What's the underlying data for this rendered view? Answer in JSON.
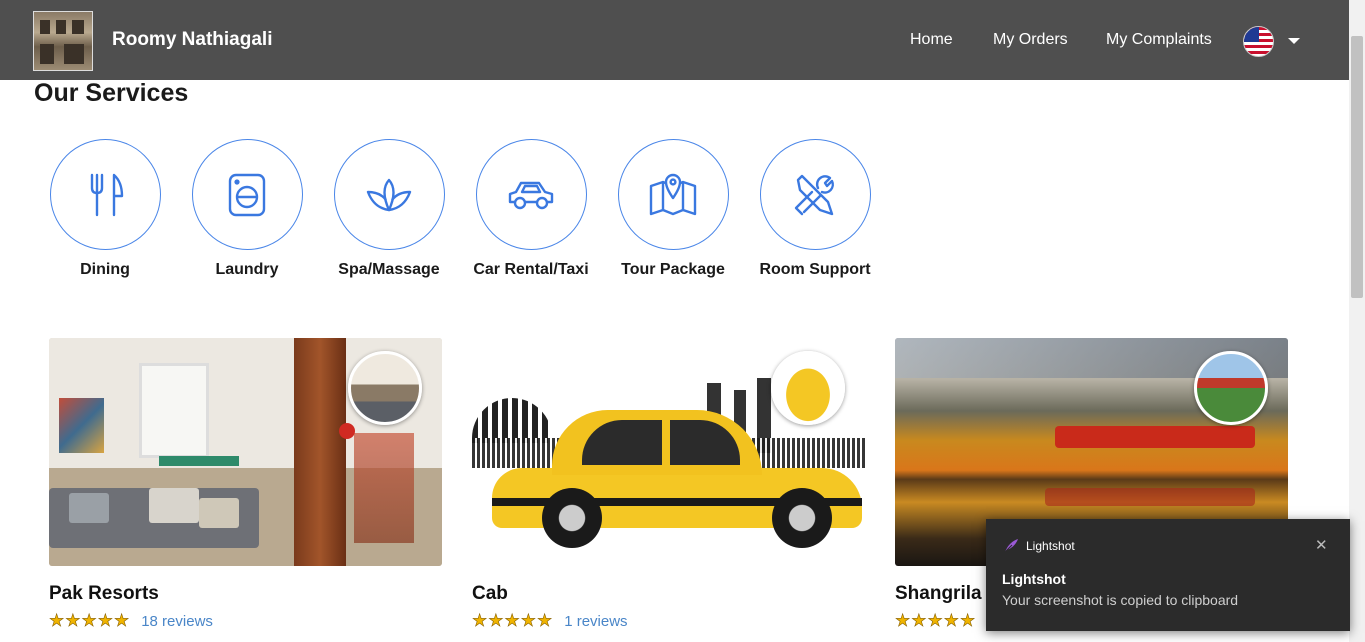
{
  "header": {
    "brand_name": "Roomy Nathiagali",
    "nav": [
      "Home",
      "My Orders",
      "My Complaints"
    ],
    "language_icon": "us-flag-icon"
  },
  "services": {
    "title": "Our Services",
    "items": [
      {
        "label": "Dining",
        "icon": "fork-knife-icon"
      },
      {
        "label": "Laundry",
        "icon": "washing-machine-icon"
      },
      {
        "label": "Spa/Massage",
        "icon": "lotus-icon"
      },
      {
        "label": "Car Rental/Taxi",
        "icon": "car-icon"
      },
      {
        "label": "Tour Package",
        "icon": "map-pin-icon"
      },
      {
        "label": "Room Support",
        "icon": "tools-icon"
      }
    ]
  },
  "listings": [
    {
      "title": "Pak Resorts",
      "stars": "★★★★★",
      "reviews": "18 reviews"
    },
    {
      "title": "Cab",
      "stars": "★★★★★",
      "reviews": "1 reviews"
    },
    {
      "title": "Shangrila",
      "stars": "★★★★★",
      "reviews": ""
    }
  ],
  "toast": {
    "app": "Lightshot",
    "title": "Lightshot",
    "message": "Your screenshot is copied to clipboard"
  },
  "colors": {
    "header_bg": "#4f4f4f",
    "accent": "#4a86e8",
    "star": "#f0b400"
  }
}
